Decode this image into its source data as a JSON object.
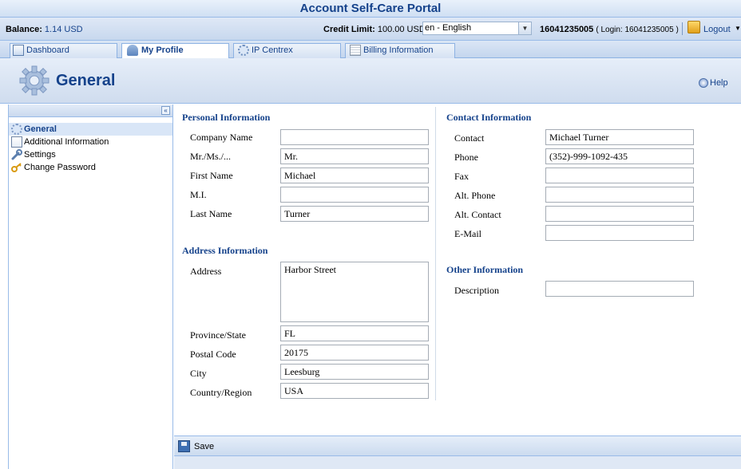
{
  "app": {
    "title": "Account Self-Care Portal"
  },
  "info_bar": {
    "balance_label": "Balance:",
    "balance_value": "1.14 USD",
    "credit_label": "Credit Limit:",
    "credit_value": "100.00 USD",
    "language": "en - English",
    "account_id": "16041235005",
    "login_text": "( Login: 16041235005 )",
    "logout_label": "Logout"
  },
  "tabs": [
    {
      "label": "Dashboard",
      "icon": "dashboard-icon"
    },
    {
      "label": "My Profile",
      "icon": "user-icon",
      "active": true
    },
    {
      "label": "IP Centrex",
      "icon": "gear-icon"
    },
    {
      "label": "Billing Information",
      "icon": "billing-icon"
    }
  ],
  "header": {
    "title": "General",
    "help_label": "Help"
  },
  "sidebar": {
    "items": [
      {
        "label": "General",
        "icon": "gear-icon",
        "active": true
      },
      {
        "label": "Additional Information",
        "icon": "document-icon"
      },
      {
        "label": "Settings",
        "icon": "wrench-icon"
      },
      {
        "label": "Change Password",
        "icon": "key-icon"
      }
    ]
  },
  "personal": {
    "title": "Personal Information",
    "company_label": "Company Name",
    "company_value": "",
    "salutation_label": "Mr./Ms./...",
    "salutation_value": "Mr.",
    "first_name_label": "First Name",
    "first_name_value": "Michael",
    "mi_label": "M.I.",
    "mi_value": "",
    "last_name_label": "Last Name",
    "last_name_value": "Turner"
  },
  "address": {
    "title": "Address Information",
    "address_label": "Address",
    "address_value": "Harbor Street",
    "province_label": "Province/State",
    "province_value": "FL",
    "postal_label": "Postal Code",
    "postal_value": "20175",
    "city_label": "City",
    "city_value": "Leesburg",
    "country_label": "Country/Region",
    "country_value": "USA"
  },
  "contact": {
    "title": "Contact Information",
    "contact_label": "Contact",
    "contact_value": "Michael Turner",
    "phone_label": "Phone",
    "phone_value": "(352)-999-1092-435",
    "fax_label": "Fax",
    "fax_value": "",
    "alt_phone_label": "Alt. Phone",
    "alt_phone_value": "",
    "alt_contact_label": "Alt. Contact",
    "alt_contact_value": "",
    "email_label": "E-Mail",
    "email_value": ""
  },
  "other": {
    "title": "Other Information",
    "description_label": "Description",
    "description_value": ""
  },
  "footer": {
    "save_label": "Save"
  }
}
